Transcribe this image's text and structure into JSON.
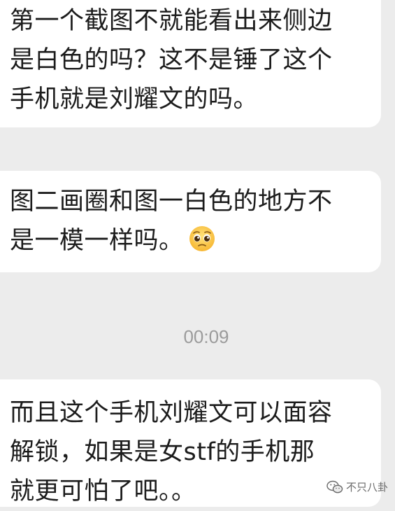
{
  "messages": [
    {
      "lines": [
        "第一个截图不就能看出来侧边",
        "是白色的吗？这不是锤了这个",
        "手机就是刘耀文的吗。"
      ]
    },
    {
      "lines": [
        "图二画圈和图一白色的地方不",
        "是一模一样吗。"
      ],
      "trailing_emoji": "pleading-face-emoji"
    },
    {
      "lines": [
        "而且这个手机刘耀文可以面容",
        "解锁，如果是女stf的手机那",
        "就更可怕了吧。。"
      ]
    }
  ],
  "timestamp": "00:09",
  "watermark": {
    "icon": "wechat-icon",
    "text": "不只八卦"
  }
}
